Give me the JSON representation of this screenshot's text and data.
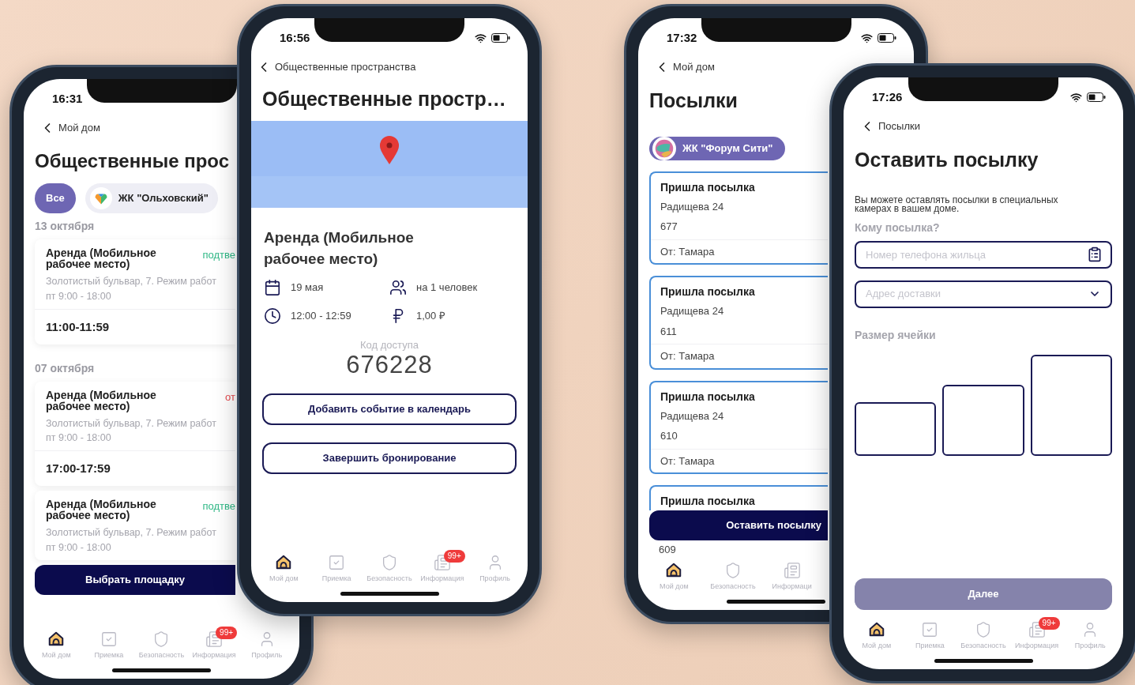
{
  "phones": [
    {
      "kind": "bookings",
      "time": "16:31",
      "back": "Мой дом",
      "title": "Общественные прос",
      "filters": [
        {
          "label": "Все",
          "selected": true,
          "logo": false
        },
        {
          "label": "ЖК \"Ольховский\"",
          "selected": false,
          "logo": true
        }
      ],
      "groups": [
        {
          "date": "13 октября",
          "bookings": [
            {
              "title": "Аренда (Мобильное рабочее место)",
              "status": "подтве",
              "color": "#2fb886",
              "address": "Золотистый бульвар, 7. Режим работ",
              "hours": "пт 9:00 - 18:00",
              "slot": "11:00-11:59"
            }
          ]
        },
        {
          "date": "07 октября",
          "bookings": [
            {
              "title": "Аренда (Мобильное рабочее место)",
              "status": "от",
              "color": "#e5484d",
              "address": "Золотистый бульвар, 7. Режим работ",
              "hours": "пт 9:00 - 18:00",
              "slot": "17:00-17:59"
            },
            {
              "title": "Аренда (Мобильное рабочее место)",
              "status": "подтве",
              "color": "#2fb886",
              "address": "Золотистый бульвар, 7. Режим работ",
              "hours": "пт 9:00 - 18:00"
            }
          ]
        }
      ],
      "cta": "Выбрать площадку",
      "nav": [
        {
          "kind": "home",
          "label": "Мой дом",
          "selected": true
        },
        {
          "kind": "reception",
          "label": "Приемка",
          "selected": false
        },
        {
          "kind": "security",
          "label": "Безопасность",
          "selected": false
        },
        {
          "kind": "info",
          "label": "Информация",
          "selected": false,
          "badge": "99+"
        },
        {
          "kind": "profile",
          "label": "Профиль",
          "selected": false
        }
      ]
    },
    {
      "kind": "detail",
      "time": "16:56",
      "back": "Общественные пространства",
      "title": "Общественные простр…",
      "heading": "Аренда (Мобильное рабочее место)",
      "facts": [
        {
          "kind": "date",
          "text": "19 мая"
        },
        {
          "kind": "people",
          "text": "на 1 человек"
        },
        {
          "kind": "time",
          "text": "12:00 - 12:59"
        },
        {
          "kind": "price",
          "text": "1,00 ₽"
        }
      ],
      "code_label": "Код доступа",
      "code": "676228",
      "buttons": [
        "Добавить событие в календарь",
        "Завершить бронирование"
      ],
      "nav": [
        {
          "kind": "home",
          "label": "Мой дом",
          "selected": true
        },
        {
          "kind": "reception",
          "label": "Приемка",
          "selected": false
        },
        {
          "kind": "security",
          "label": "Безопасность",
          "selected": false
        },
        {
          "kind": "info",
          "label": "Информация",
          "selected": false,
          "badge": "99+"
        },
        {
          "kind": "profile",
          "label": "Профиль",
          "selected": false
        }
      ]
    },
    {
      "kind": "parcels",
      "time": "17:32",
      "back": "Мой дом",
      "title": "Посылки",
      "chip": {
        "label": "ЖК \"Форум Сити\"",
        "selected": true
      },
      "parcels": [
        {
          "title": "Пришла посылка",
          "address": "Радищева 24",
          "number": "677",
          "from": "От: Тамара"
        },
        {
          "title": "Пришла посылка",
          "address": "Радищева 24",
          "number": "611",
          "from": "От: Тамара"
        },
        {
          "title": "Пришла посылка",
          "address": "Радищева 24",
          "number": "610",
          "from": "От: Тамара"
        },
        {
          "title": "Пришла посылка",
          "number": "609"
        }
      ],
      "cta": "Оставить посылку",
      "nav": [
        {
          "kind": "home",
          "label": "Мой дом",
          "selected": true
        },
        {
          "kind": "security",
          "label": "Безопасность",
          "selected": false
        },
        {
          "kind": "info",
          "label": "Информаци",
          "selected": false
        }
      ]
    },
    {
      "kind": "send",
      "time": "17:26",
      "back": "Посылки",
      "title": "Оставить посылку",
      "description": "Вы можете оставлять посылки в специальных камерах в вашем доме.",
      "recipient_label": "Кому посылка?",
      "phone_placeholder": "Номер телефона жильца",
      "address_placeholder": "Адрес доставки",
      "size_label": "Размер ячейки",
      "sizes": [
        {
          "kind": "small",
          "selected": false
        },
        {
          "kind": "medium",
          "selected": false
        },
        {
          "kind": "large",
          "selected": false
        }
      ],
      "next": {
        "label": "Далее",
        "disabled": true
      },
      "nav": [
        {
          "kind": "home",
          "label": "Мой дом",
          "selected": true
        },
        {
          "kind": "reception",
          "label": "Приемка",
          "selected": false
        },
        {
          "kind": "security",
          "label": "Безопасность",
          "selected": false
        },
        {
          "kind": "info",
          "label": "Информация",
          "selected": false,
          "badge": "99+"
        },
        {
          "kind": "profile",
          "label": "Профиль",
          "selected": false
        }
      ]
    }
  ]
}
